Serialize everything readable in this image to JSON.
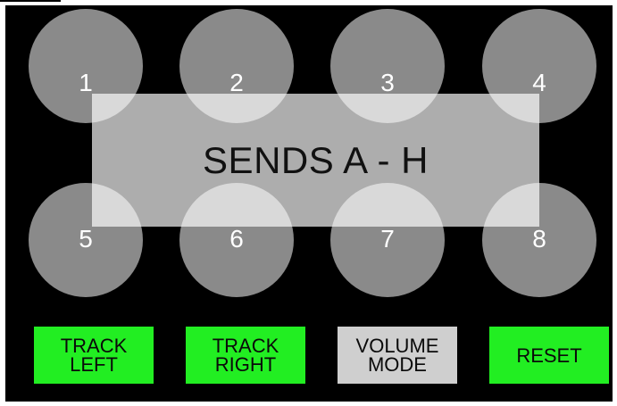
{
  "pads": [
    "1",
    "2",
    "3",
    "4",
    "5",
    "6",
    "7",
    "8"
  ],
  "overlay_label": "SENDS A - H",
  "buttons": [
    {
      "label": "TRACK\nLEFT",
      "color": "#22ee22"
    },
    {
      "label": "TRACK\nRIGHT",
      "color": "#22ee22"
    },
    {
      "label": "VOLUME\nMODE",
      "color": "#cfcfcf"
    },
    {
      "label": "RESET",
      "color": "#22ee22"
    }
  ],
  "colors": {
    "background": "#000000",
    "pad": "#8a8a8a",
    "active_button": "#22ee22",
    "inactive_button": "#cfcfcf"
  }
}
